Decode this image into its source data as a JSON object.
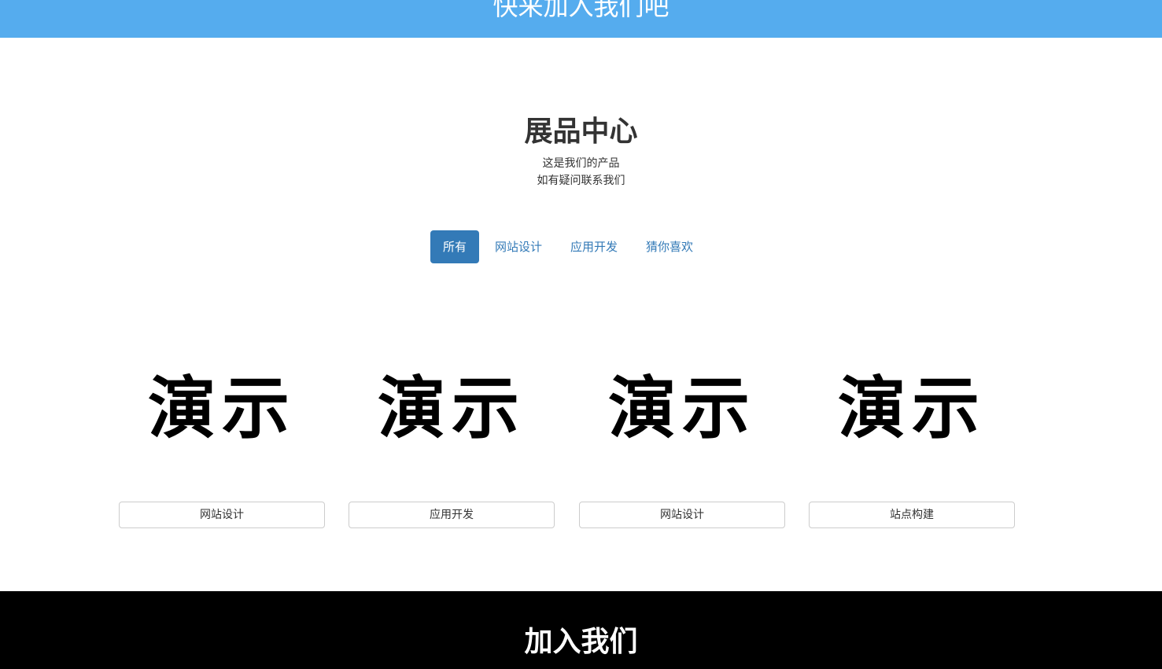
{
  "banner": {
    "title": "快来加入我们吧",
    "background": "#55acee"
  },
  "products": {
    "title": "展品中心",
    "subtitle_line1": "这是我们的产品",
    "subtitle_line2": "如有疑问联系我们",
    "filters": [
      {
        "label": "所有",
        "active": true
      },
      {
        "label": "网站设计",
        "active": false
      },
      {
        "label": "应用开发",
        "active": false
      },
      {
        "label": "猜你喜欢",
        "active": false
      }
    ],
    "items": [
      {
        "image_text": "演示",
        "button_label": "网站设计"
      },
      {
        "image_text": "演示",
        "button_label": "应用开发"
      },
      {
        "image_text": "演示",
        "button_label": "网站设计"
      },
      {
        "image_text": "演示",
        "button_label": "站点构建"
      }
    ]
  },
  "footer": {
    "title": "加入我们"
  },
  "colors": {
    "accent": "#337ab7",
    "banner": "#55acee",
    "footer": "#000000"
  }
}
